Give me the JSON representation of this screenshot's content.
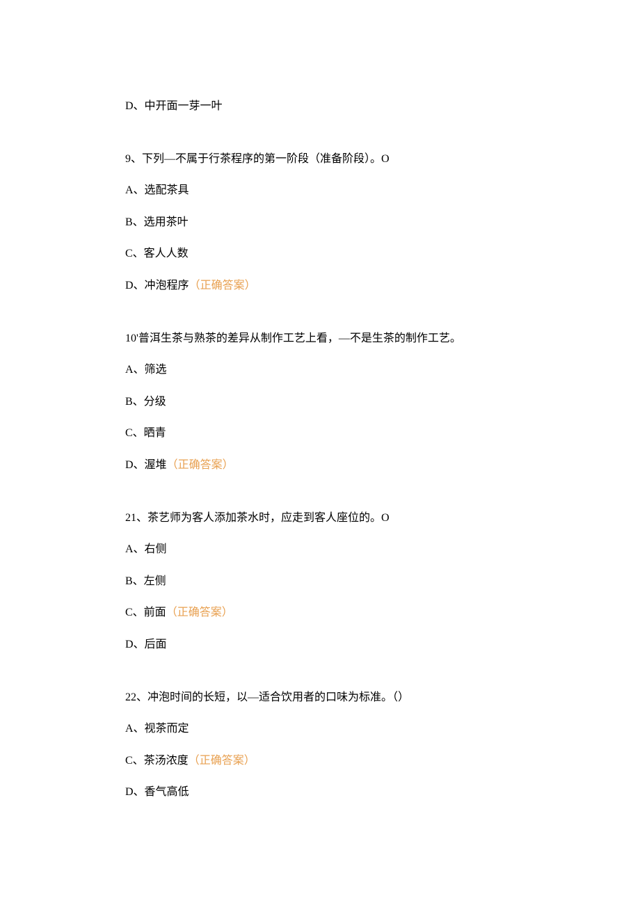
{
  "lines": [
    {
      "text": "D、中开面一芽一叶",
      "spaced": false
    },
    {
      "text": "9、下列―不属于行茶程序的第一阶段（准备阶段）。O",
      "spaced": true
    },
    {
      "text": "A、选配茶具",
      "spaced": false
    },
    {
      "text": "B、选用茶叶",
      "spaced": false
    },
    {
      "text": "C、客人人数",
      "spaced": false
    },
    {
      "text": "D、冲泡程序",
      "answer": "（正确答案）",
      "spaced": false
    },
    {
      "text": "10'普洱生茶与熟茶的差异从制作工艺上看，―不是生茶的制作工艺。",
      "spaced": true
    },
    {
      "text": "A、筛选",
      "spaced": false
    },
    {
      "text": "B、分级",
      "spaced": false
    },
    {
      "text": "C、晒青",
      "spaced": false
    },
    {
      "text": "D、渥堆",
      "answer": "（正确答案）",
      "spaced": false
    },
    {
      "text": "21、茶艺师为客人添加茶水时，应走到客人座位的。O",
      "spaced": true
    },
    {
      "text": "A、右侧",
      "spaced": false
    },
    {
      "text": "B、左侧",
      "spaced": false
    },
    {
      "text": "C、前面",
      "answer": "（正确答案）",
      "spaced": false
    },
    {
      "text": "D、后面",
      "spaced": false
    },
    {
      "text": "22、冲泡时间的长短，以―适合饮用者的口味为标准。（）",
      "spaced": true
    },
    {
      "text": "A、视茶而定",
      "spaced": false
    },
    {
      "text": "C、茶汤浓度",
      "answer": "（正确答案）",
      "spaced": false
    },
    {
      "text": "D、香气高低",
      "spaced": false
    }
  ]
}
